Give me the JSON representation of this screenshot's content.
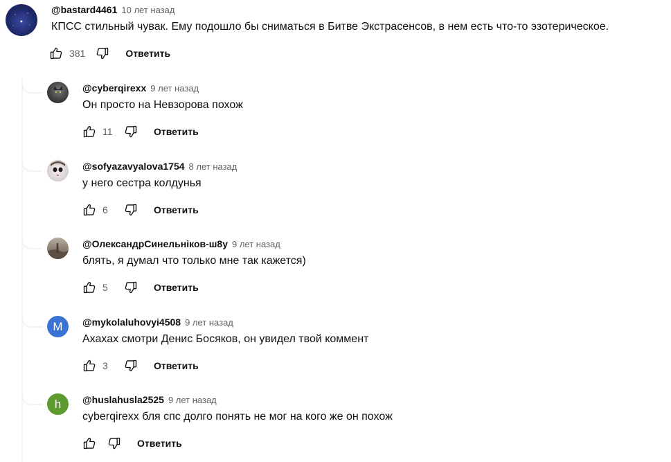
{
  "labels": {
    "reply": "Ответить"
  },
  "comments": [
    {
      "author": "@bastard4461",
      "time": "10 лет назад",
      "text": "КПСС стильный чувак. Ему подошло бы сниматься в Битве Экстрасенсов, в нем есть что-то эзотерическое.",
      "likes": "381",
      "avatar": {
        "type": "image",
        "icon": "starry-sky-avatar",
        "color": "#1f2a6a"
      }
    }
  ],
  "replies": [
    {
      "author": "@cyberqirexx",
      "time": "9 лет назад",
      "text": "Он просто на Невзорова похож",
      "likes": "11",
      "avatar": {
        "type": "image",
        "icon": "cat-photo-avatar",
        "color": "#4a4a4a"
      }
    },
    {
      "author": "@sofyazavyalova1754",
      "time": "8 лет назад",
      "text": "у него сестра колдунья",
      "likes": "6",
      "avatar": {
        "type": "image",
        "icon": "doll-face-avatar",
        "color": "#d8d2d2"
      }
    },
    {
      "author": "@ОлександрСинельніков-ш8у",
      "time": "9 лет назад",
      "text": "блять, я думал что только мне так кажется)",
      "likes": "5",
      "avatar": {
        "type": "image",
        "icon": "landscape-photo-avatar",
        "color": "#8a7d70"
      }
    },
    {
      "author": "@mykolaluhovyi4508",
      "time": "9 лет назад",
      "text": "Ахахах смотри Денис Босяков, он увидел твой коммент",
      "likes": "3",
      "avatar": {
        "type": "letter",
        "letter": "M",
        "color": "#3b73d4"
      }
    },
    {
      "author": "@huslahusla2525",
      "time": "9 лет назад",
      "text": "cyberqirexx бля спс долго понять не мог на кого же он похож",
      "likes": "",
      "avatar": {
        "type": "letter",
        "letter": "h",
        "color": "#5c9b2f"
      }
    }
  ]
}
